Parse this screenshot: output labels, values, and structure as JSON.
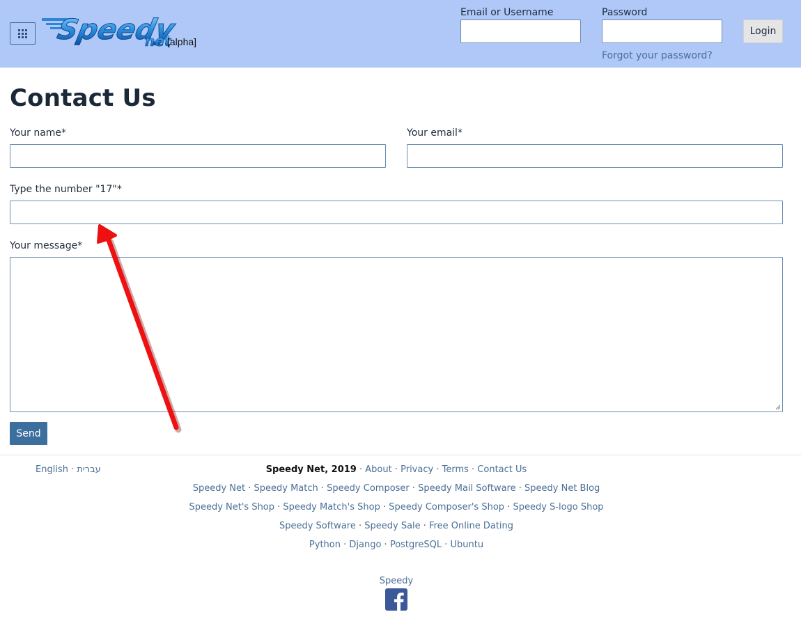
{
  "header": {
    "logo_text": "Speedy",
    "logo_suffix": "net",
    "logo_alpha": "[alpha]",
    "email_label": "Email or Username",
    "password_label": "Password",
    "login_button": "Login",
    "forgot_password": "Forgot your password?"
  },
  "main": {
    "title": "Contact Us",
    "name_label": "Your name*",
    "email_label": "Your email*",
    "captcha_label": "Type the number \"17\"*",
    "message_label": "Your message*",
    "send_button": "Send"
  },
  "footer": {
    "languages": [
      "English",
      "עברית"
    ],
    "brand": "Speedy Net, 2019",
    "line1_links": [
      "About",
      "Privacy",
      "Terms",
      "Contact Us"
    ],
    "line2_links": [
      "Speedy Net",
      "Speedy Match",
      "Speedy Composer",
      "Speedy Mail Software",
      "Speedy Net Blog"
    ],
    "line3_links": [
      "Speedy Net's Shop",
      "Speedy Match's Shop",
      "Speedy Composer's Shop",
      "Speedy S-logo Shop"
    ],
    "line4_links": [
      "Speedy Software",
      "Speedy Sale",
      "Free Online Dating"
    ],
    "line5_links": [
      "Python",
      "Django",
      "PostgreSQL",
      "Ubuntu"
    ],
    "social_label": "Speedy",
    "social_icon": "facebook-icon"
  },
  "colors": {
    "header_bg": "#b0c8f7",
    "link": "#4a6f96",
    "send_button": "#3d6f9e",
    "annotation_arrow": "#ee1111"
  }
}
